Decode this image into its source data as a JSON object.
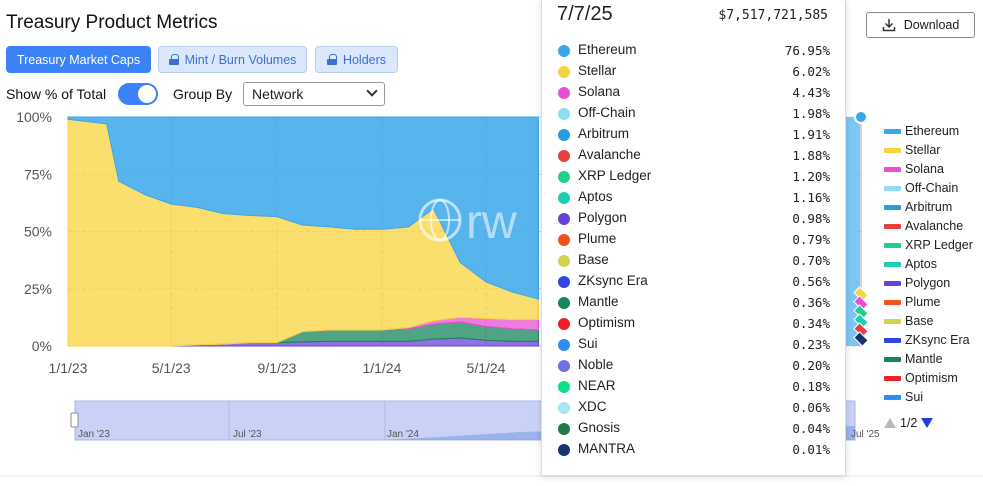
{
  "page": {
    "title": "Treasury Product Metrics"
  },
  "tabs": [
    {
      "label": "Treasury Market Caps",
      "active": true
    },
    {
      "label": "Mint / Burn Volumes",
      "locked": true
    },
    {
      "label": "Holders",
      "locked": true
    }
  ],
  "controls": {
    "show_pct_label": "Show % of Total",
    "show_pct_enabled": true,
    "group_by_label": "Group By",
    "group_by_value": "Network"
  },
  "download_label": "Download",
  "tooltip": {
    "date": "7/7/25",
    "total": "$7,517,721,585",
    "rows": [
      {
        "name": "Ethereum",
        "value": "76.95%",
        "color": "#3ba7ea"
      },
      {
        "name": "Stellar",
        "value": "6.02%",
        "color": "#f8d33d"
      },
      {
        "name": "Solana",
        "value": "4.43%",
        "color": "#e74fd6"
      },
      {
        "name": "Off-Chain",
        "value": "1.98%",
        "color": "#8fdcf4"
      },
      {
        "name": "Arbitrum",
        "value": "1.91%",
        "color": "#2a9ae0"
      },
      {
        "name": "Avalanche",
        "value": "1.88%",
        "color": "#e8403f"
      },
      {
        "name": "XRP Ledger",
        "value": "1.20%",
        "color": "#20d08a"
      },
      {
        "name": "Aptos",
        "value": "1.16%",
        "color": "#1fcdb5"
      },
      {
        "name": "Polygon",
        "value": "0.98%",
        "color": "#6a41d8"
      },
      {
        "name": "Plume",
        "value": "0.79%",
        "color": "#f0521d"
      },
      {
        "name": "Base",
        "value": "0.70%",
        "color": "#d2d34a"
      },
      {
        "name": "ZKsync Era",
        "value": "0.56%",
        "color": "#2f46e3"
      },
      {
        "name": "Mantle",
        "value": "0.36%",
        "color": "#16855a"
      },
      {
        "name": "Optimism",
        "value": "0.34%",
        "color": "#f0202a"
      },
      {
        "name": "Sui",
        "value": "0.23%",
        "color": "#2b8ef0"
      },
      {
        "name": "Noble",
        "value": "0.20%",
        "color": "#7070e0"
      },
      {
        "name": "NEAR",
        "value": "0.18%",
        "color": "#0fe08a"
      },
      {
        "name": "XDC",
        "value": "0.06%",
        "color": "#a8e6ee"
      },
      {
        "name": "Gnosis",
        "value": "0.04%",
        "color": "#1f7a4a"
      },
      {
        "name": "MANTRA",
        "value": "0.01%",
        "color": "#17346e"
      }
    ]
  },
  "legend": {
    "items": [
      {
        "name": "Ethereum",
        "color": "#3ba7ea"
      },
      {
        "name": "Stellar",
        "color": "#f8d33d"
      },
      {
        "name": "Solana",
        "color": "#e74fd6"
      },
      {
        "name": "Off-Chain",
        "color": "#8fdcf4"
      },
      {
        "name": "Arbitrum",
        "color": "#2a9ae0"
      },
      {
        "name": "Avalanche",
        "color": "#e8403f"
      },
      {
        "name": "XRP Ledger",
        "color": "#20d08a"
      },
      {
        "name": "Aptos",
        "color": "#1fcdb5"
      },
      {
        "name": "Polygon",
        "color": "#6a41d8"
      },
      {
        "name": "Plume",
        "color": "#f0521d"
      },
      {
        "name": "Base",
        "color": "#d2d34a"
      },
      {
        "name": "ZKsync Era",
        "color": "#2f46e3"
      },
      {
        "name": "Mantle",
        "color": "#16855a"
      },
      {
        "name": "Optimism",
        "color": "#f0202a"
      },
      {
        "name": "Sui",
        "color": "#2b8ef0"
      }
    ],
    "page": "1/2"
  },
  "chart_data": {
    "type": "area",
    "stacked": true,
    "normalized": true,
    "x": [
      "1/1/23",
      "2/15/23",
      "3/1/23",
      "4/1/23",
      "5/1/23",
      "6/1/23",
      "7/1/23",
      "8/1/23",
      "9/1/23",
      "10/1/23",
      "11/1/23",
      "12/1/23",
      "1/1/24",
      "2/1/24",
      "3/1/24",
      "4/1/24",
      "5/1/24",
      "6/1/24",
      "7/1/24"
    ],
    "x_ticks": [
      "1/1/23",
      "5/1/23",
      "9/1/23",
      "1/1/24",
      "5/1/24"
    ],
    "y_ticks": [
      "0%",
      "25%",
      "50%",
      "75%",
      "100%"
    ],
    "ylim": [
      0,
      100
    ],
    "grid": true,
    "series": [
      {
        "name": "Polygon",
        "values": [
          0,
          0,
          0,
          0,
          0,
          0.5,
          0.8,
          1.5,
          1.5,
          1.8,
          2.0,
          2.0,
          2.0,
          2.0,
          3.0,
          3.5,
          2.5,
          2.0,
          2.0
        ]
      },
      {
        "name": "Mantle",
        "values": [
          0,
          0,
          0,
          0,
          0,
          0,
          0,
          0,
          0,
          4.5,
          5.0,
          5.0,
          5.0,
          5.5,
          6.5,
          7.0,
          6.0,
          5.5,
          5.0
        ]
      },
      {
        "name": "Solana",
        "values": [
          0,
          0,
          0,
          0,
          0,
          0,
          0,
          0,
          0,
          0,
          0,
          0,
          0,
          0.5,
          1.5,
          2.0,
          3.5,
          4.0,
          4.5
        ]
      },
      {
        "name": "Stellar",
        "values": [
          99,
          97,
          72,
          66,
          62,
          60,
          57,
          55.5,
          55,
          46.5,
          45,
          44,
          44,
          44,
          49,
          24,
          16,
          12,
          9
        ]
      },
      {
        "name": "Ethereum",
        "values": [
          1,
          3,
          28,
          34,
          38,
          39.5,
          42.2,
          43,
          43.5,
          47.2,
          48,
          49,
          49,
          48,
          40,
          63.5,
          72,
          76.5,
          79.5
        ]
      }
    ],
    "brush_ticks": [
      "Jan '23",
      "Jul '23",
      "Jan '24",
      "Jul '25"
    ],
    "watermark": "rw"
  }
}
